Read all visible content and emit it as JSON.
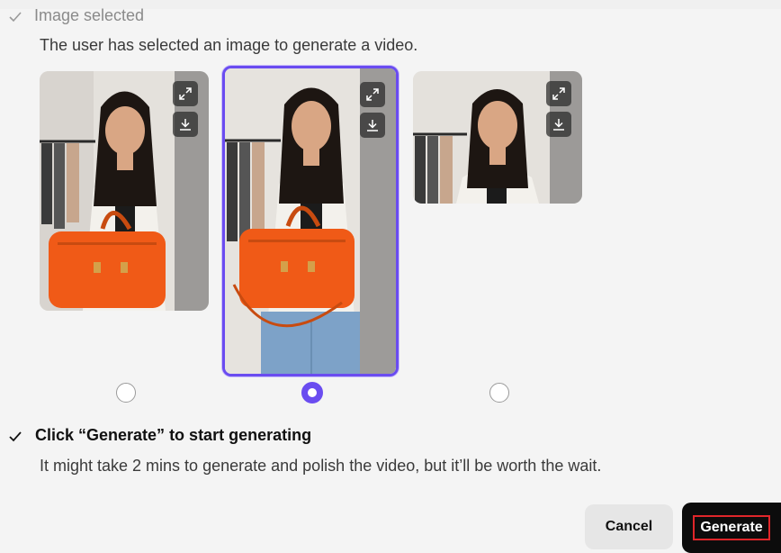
{
  "step1": {
    "title": "Image selected",
    "description": "The user has selected an image to generate a video."
  },
  "images": [
    {
      "label": "image-option-1",
      "selected": false,
      "expand_icon": "expand-icon",
      "download_icon": "download-icon"
    },
    {
      "label": "image-option-2",
      "selected": true,
      "expand_icon": "expand-icon",
      "download_icon": "download-icon"
    },
    {
      "label": "image-option-3",
      "selected": false,
      "expand_icon": "expand-icon",
      "download_icon": "download-icon"
    }
  ],
  "step2": {
    "title": "Click “Generate” to start generating",
    "description": "It might take 2 mins to generate and polish the video, but it’ll be worth the wait."
  },
  "actions": {
    "cancel_label": "Cancel",
    "generate_label": "Generate"
  },
  "colors": {
    "accent": "#6a4cf0",
    "highlight_border": "#e0262a",
    "bag": "#f05a17"
  }
}
